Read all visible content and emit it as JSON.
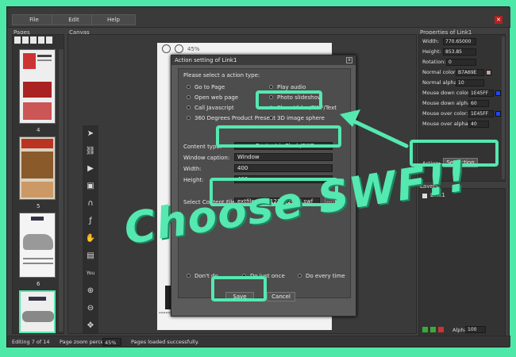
{
  "menu": {
    "file": "File",
    "edit": "Edit",
    "help": "Help"
  },
  "panels": {
    "pages": "Pages",
    "canvas": "Canvas",
    "properties": "Properties of Link1",
    "layers": "Layers"
  },
  "page_numbers": [
    "4",
    "5",
    "6"
  ],
  "canvas_zoom": "45%",
  "dialog": {
    "title": "Action setting of Link1",
    "prompt": "Please select a action type:",
    "left_options": [
      "Go to Page",
      "Open web page",
      "Call Javascript",
      "360 Degrees Product Present"
    ],
    "right_options": [
      "Play audio",
      "Photo slideshow",
      "Show Video/SWF/Text",
      "3D image sphere"
    ],
    "content_type_label": "Content type:",
    "content_type_value": "Content is Flash/SWF",
    "window_caption_label": "Window caption:",
    "window_caption_value": "Window",
    "width_label": "Width:",
    "width_value": "400",
    "height_label": "Height:",
    "height_value": "400",
    "select_file_label": "Select Content File:",
    "select_file_value": "extfiles/130121152604.swf",
    "browse": "...",
    "options": [
      "Don't do",
      "Do just once",
      "Do every time"
    ],
    "save": "Save",
    "cancel": "Cancel"
  },
  "annotation": "Choose SWF!!",
  "properties": {
    "width_label": "Width:",
    "width_value": "770.65000",
    "height_label": "Height:",
    "height_value": "853.85",
    "rotation_label": "Rotation:",
    "rotation_value": "0",
    "normal_color_label": "Normal color:",
    "normal_color_value": "B7A69E",
    "normal_alpha_label": "Normal alpha:",
    "normal_alpha_value": "10",
    "mouse_down_color_label": "Mouse down color:",
    "mouse_down_color_value": "1E45FF",
    "mouse_down_alpha_label": "Mouse down alpha:",
    "mouse_down_alpha_value": "60",
    "mouse_over_color_label": "Mouse over color:",
    "mouse_over_color_value": "1E45FF",
    "mouse_over_alpha_label": "Mouse over alpha:",
    "mouse_over_alpha_value": "40",
    "action_label": "Action:",
    "set_action": "Set action"
  },
  "layers": {
    "item": "Link1",
    "alpha_label": "Alpha:",
    "alpha_value": "100"
  },
  "status": {
    "editing": "Editing 7 of 14",
    "zoom_label": "Page zoom percent:",
    "zoom_value": "45%",
    "message": "Pages loaded successfully."
  },
  "colors": {
    "accent": "#55e8b0",
    "background": "#4ee8a8",
    "normal_color": "#B7A69E",
    "mouse_color": "#1E45FF"
  },
  "icons": [
    "arrow-pointer-icon",
    "link-icon",
    "video-camera-icon",
    "image-icon",
    "headphones-icon",
    "flash-icon",
    "hand-icon",
    "picture-icon",
    "youtube-icon",
    "zoom-in-icon",
    "zoom-out-icon",
    "pan-icon"
  ]
}
